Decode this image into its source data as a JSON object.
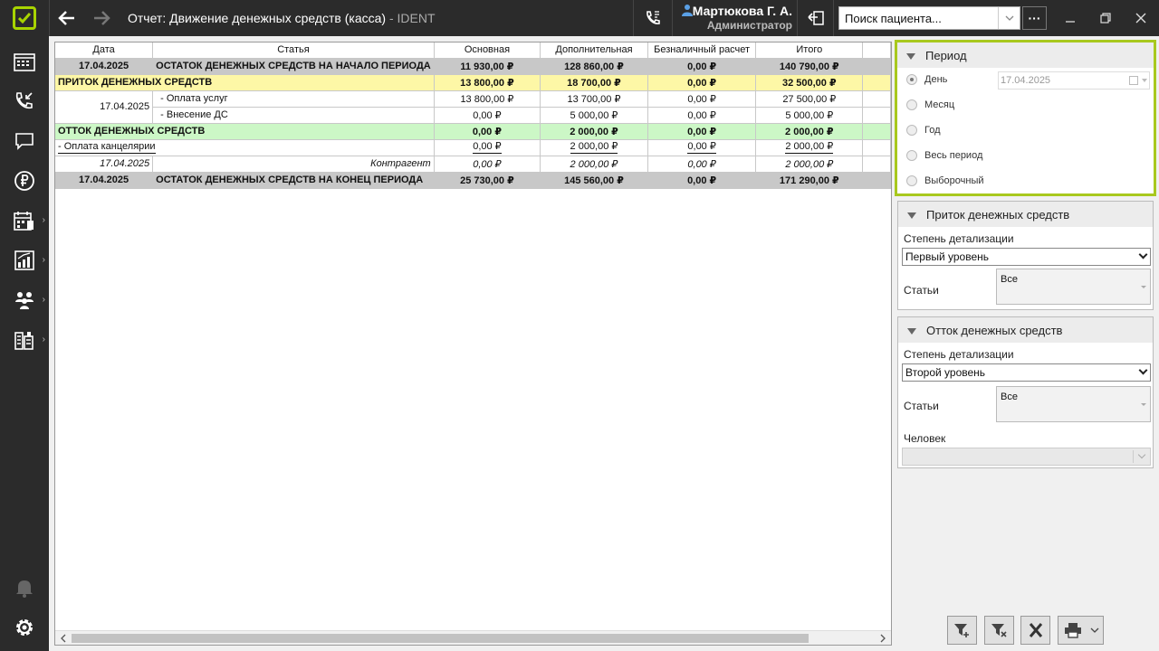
{
  "topbar": {
    "title": "Отчет: Движение денежных средств (касса)",
    "app_name": " - IDENT",
    "user_name": "Мартюкова Г. А.",
    "user_role": "Администратор",
    "search_placeholder": "Поиск пациента...",
    "more_label": "···"
  },
  "table": {
    "headers": [
      "Дата",
      "Статья",
      "Основная",
      "Дополнительная",
      "Безналичный расчет",
      "Итого"
    ],
    "opening": {
      "date": "17.04.2025",
      "label": "ОСТАТОК ДЕНЕЖНЫХ СРЕДСТВ НА НАЧАЛО ПЕРИОДА",
      "main": "11 930,00 ₽",
      "extra": "128 860,00 ₽",
      "noncash": "0,00 ₽",
      "total": "140 790,00 ₽"
    },
    "inflow": {
      "label": "ПРИТОК ДЕНЕЖНЫХ СРЕДСТВ",
      "main": "13 800,00 ₽",
      "extra": "18 700,00 ₽",
      "noncash": "0,00 ₽",
      "total": "32 500,00 ₽"
    },
    "inflow_date": "17.04.2025",
    "inflow_rows": [
      {
        "label": " - Оплата услуг",
        "main": "13 800,00 ₽",
        "extra": "13 700,00 ₽",
        "noncash": "0,00 ₽",
        "total": "27 500,00 ₽"
      },
      {
        "label": " - Внесение ДС",
        "main": "0,00 ₽",
        "extra": "5 000,00 ₽",
        "noncash": "0,00 ₽",
        "total": "5 000,00 ₽"
      }
    ],
    "outflow": {
      "label": "ОТТОК ДЕНЕЖНЫХ СРЕДСТВ",
      "main": "0,00 ₽",
      "extra": "2 000,00 ₽",
      "noncash": "0,00 ₽",
      "total": "2 000,00 ₽"
    },
    "outflow_group": {
      "label": " - Оплата канцелярии",
      "main": "0,00 ₽",
      "extra": "2 000,00 ₽",
      "noncash": "0,00 ₽",
      "total": "2 000,00 ₽"
    },
    "outflow_detail": {
      "date": "17.04.2025",
      "label": "Контрагент",
      "main": "0,00 ₽",
      "extra": "2 000,00 ₽",
      "noncash": "0,00 ₽",
      "total": "2 000,00 ₽"
    },
    "closing": {
      "date": "17.04.2025",
      "label": "ОСТАТОК ДЕНЕЖНЫХ СРЕДСТВ НА КОНЕЦ ПЕРИОДА",
      "main": "25 730,00 ₽",
      "extra": "145 560,00 ₽",
      "noncash": "0,00 ₽",
      "total": "171 290,00 ₽"
    }
  },
  "period_panel": {
    "title": "Период",
    "options": [
      "День",
      "Месяц",
      "Год",
      "Весь период",
      "Выборочный"
    ],
    "selected": "День",
    "date": "17.04.2025"
  },
  "inflow_panel": {
    "title": "Приток денежных средств",
    "detail_label": "Степень детализации",
    "detail_value": "Первый уровень",
    "articles_label": "Статьи",
    "articles_value": "Все"
  },
  "outflow_panel": {
    "title": "Отток денежных средств",
    "detail_label": "Степень детализации",
    "detail_value": "Второй уровень",
    "articles_label": "Статьи",
    "articles_value": "Все",
    "person_label": "Человек"
  },
  "colors": {
    "accent": "#a8d400",
    "dark": "#2b2b2b",
    "gray_row": "#c8c8c8",
    "yellow_row": "#fdf7a6",
    "green_row": "#ccf7c6"
  }
}
